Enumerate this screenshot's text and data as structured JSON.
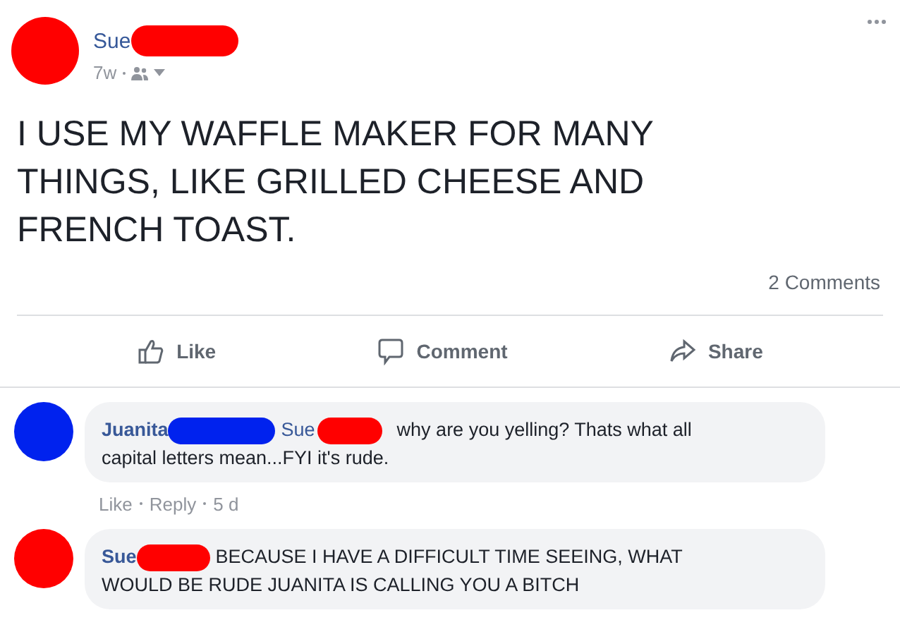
{
  "post": {
    "author": "Sue",
    "time": "7w",
    "text_lines": [
      "I USE MY WAFFLE MAKER FOR MANY",
      "THINGS, LIKE GRILLED CHEESE AND",
      "FRENCH TOAST."
    ],
    "comment_count": "2 Comments"
  },
  "actions": [
    {
      "kind": "like",
      "label": "Like"
    },
    {
      "kind": "comment",
      "label": "Comment"
    },
    {
      "kind": "share",
      "label": "Share"
    }
  ],
  "comments": [
    {
      "author": "Juanita",
      "color": "#0022ee",
      "mention": "Sue",
      "text_lines": [
        "why are you yelling? Thats what all",
        "capital letters mean...FYI it's rude."
      ],
      "meta": {
        "like": "Like",
        "reply": "Reply",
        "time": "5 d"
      }
    },
    {
      "author": "Sue",
      "color": "#ff0000",
      "text_lines": [
        "BECAUSE I HAVE A DIFFICULT TIME SEEING, WHAT",
        "WOULD BE RUDE JUANITA IS CALLING YOU A BITCH"
      ]
    }
  ]
}
